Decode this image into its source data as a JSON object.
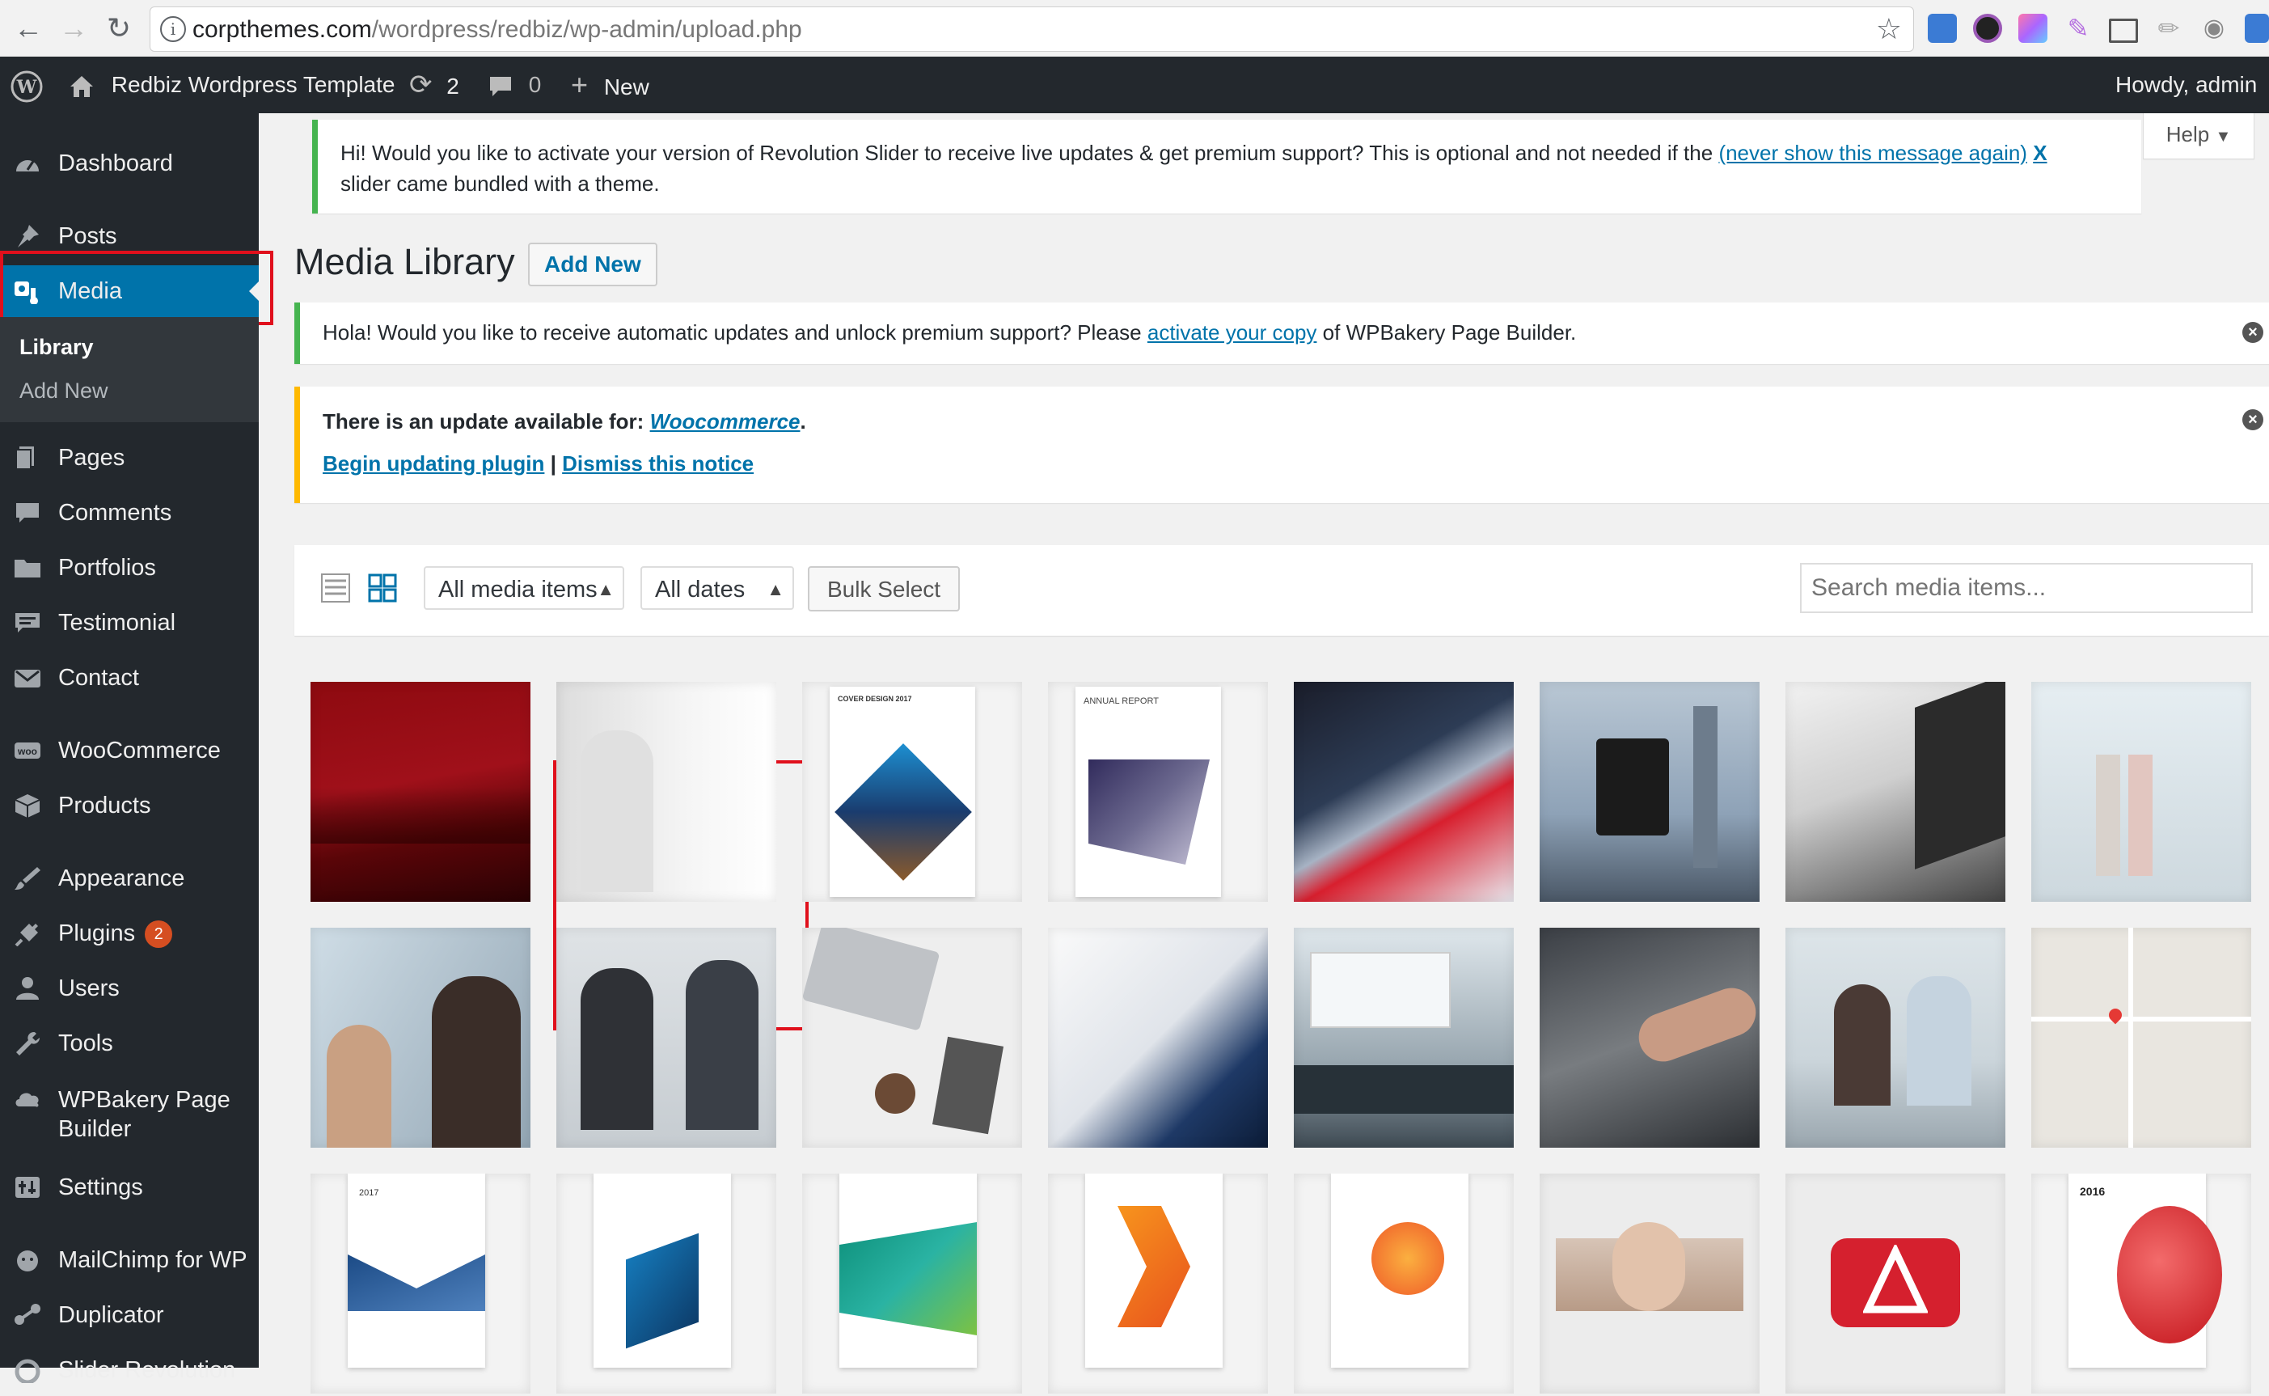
{
  "browser": {
    "url_domain": "corpthemes.com",
    "url_path": "/wordpress/redbiz/wp-admin/upload.php"
  },
  "adminbar": {
    "site_name": "Redbiz Wordpress Template",
    "updates_count": "2",
    "comments_count": "0",
    "new_label": "New",
    "howdy": "Howdy, admin"
  },
  "sidebar": {
    "items": [
      {
        "label": "Dashboard",
        "icon": "dashboard-icon"
      },
      {
        "label": "Posts",
        "icon": "pin-icon"
      },
      {
        "label": "Media",
        "icon": "media-icon"
      },
      {
        "label": "Pages",
        "icon": "pages-icon"
      },
      {
        "label": "Comments",
        "icon": "comment-icon"
      },
      {
        "label": "Portfolios",
        "icon": "folder-icon"
      },
      {
        "label": "Testimonial",
        "icon": "testimonial-icon"
      },
      {
        "label": "Contact",
        "icon": "mail-icon"
      },
      {
        "label": "WooCommerce",
        "icon": "woo-icon"
      },
      {
        "label": "Products",
        "icon": "box-icon"
      },
      {
        "label": "Appearance",
        "icon": "brush-icon"
      },
      {
        "label": "Plugins",
        "icon": "plug-icon",
        "badge": "2"
      },
      {
        "label": "Users",
        "icon": "user-icon"
      },
      {
        "label": "Tools",
        "icon": "wrench-icon"
      },
      {
        "label": "WPBakery Page",
        "label2": "Builder",
        "icon": "cloud-icon"
      },
      {
        "label": "Settings",
        "icon": "settings-icon"
      },
      {
        "label": "MailChimp for WP",
        "icon": "mailchimp-icon"
      },
      {
        "label": "Duplicator",
        "icon": "duplicator-icon"
      },
      {
        "label": "Slider Revolution",
        "icon": "slider-icon"
      }
    ],
    "submenu": {
      "library": "Library",
      "add_new": "Add New"
    }
  },
  "notices": {
    "revslider": {
      "text1": "Hi! Would you like to activate your version of Revolution Slider to receive live updates & get premium support? This is optional and not needed if the",
      "link": "(never show this message again)",
      "x": "X",
      "text2": "slider came bundled with a theme."
    },
    "wpbakery": {
      "before": "Hola! Would you like to receive automatic updates and unlock premium support? Please",
      "link": "activate your copy",
      "after": "of WPBakery Page Builder."
    },
    "woocommerce": {
      "before": "There is an update available for:",
      "plugin": "Woocommerce",
      "begin": "Begin updating plugin",
      "sep": "|",
      "dismiss": "Dismiss this notice"
    }
  },
  "help_label": "Help",
  "page": {
    "title": "Media Library",
    "add_new": "Add New"
  },
  "toolbar": {
    "filter_type": "All media items",
    "filter_date": "All dates",
    "bulk_select": "Bulk Select",
    "search_placeholder": "Search media items..."
  },
  "colors": {
    "admin_bg": "#23282d",
    "accent": "#0073aa",
    "highlight": "#e0101c",
    "badge": "#d54e21"
  },
  "media": [
    "red-abstract-image",
    "business-handshake-image",
    "cover-design-2017-image",
    "annual-report-cover-image",
    "red-building-facade-image",
    "camera-cityscape-image",
    "laptop-camera-desk-image",
    "office-women-walking-image",
    "women-meeting-image",
    "business-handshake-office-image",
    "laptop-desk-top-view-image",
    "signing-document-image",
    "conference-room-image",
    "pointing-at-laptop-image",
    "business-meeting-cafe-image",
    "map-image",
    "annual-report-2017-image",
    "innovative-technology-brochure-image",
    "revolutionary-ideas-brochure-image",
    "orange-arrow-brochure-image",
    "annual-report-orange-image",
    "smiling-man-portrait-image",
    "red-triangle-logo-image",
    "annual-report-2016-image"
  ],
  "media_texts": {
    "cover_design": "COVER DESIGN 2017",
    "annual_report": "ANNUAL REPORT",
    "year_2017": "2017",
    "year_2016": "2016"
  }
}
